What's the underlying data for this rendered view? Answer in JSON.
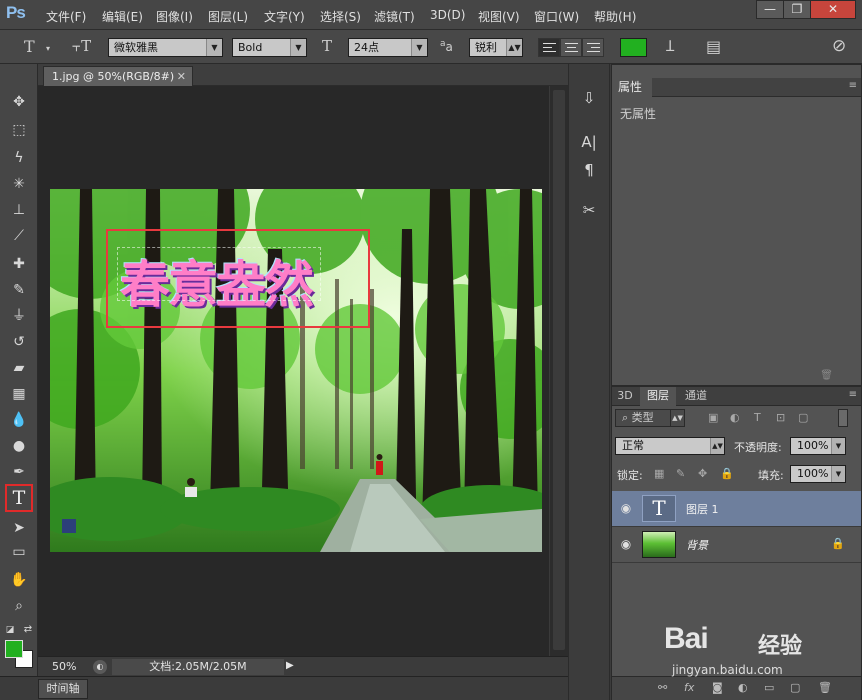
{
  "app": {
    "logo": "Ps"
  },
  "menu": [
    "文件(F)",
    "编辑(E)",
    "图像(I)",
    "图层(L)",
    "文字(Y)",
    "选择(S)",
    "滤镜(T)",
    "3D(D)",
    "视图(V)",
    "窗口(W)",
    "帮助(H)"
  ],
  "window_controls": {
    "minimize": "—",
    "restore": "❐",
    "close": "✕"
  },
  "options": {
    "font_family": "微软雅黑",
    "font_style": "Bold",
    "font_size": "24点",
    "aa_label": "a",
    "anti_alias": "锐利",
    "text_color": "#22b020"
  },
  "document": {
    "tab_title": "1.jpg @ 50%(RGB/8#)",
    "canvas_text": "春意盎然",
    "zoom": "50%",
    "doc_size": "文档:2.05M/2.05M",
    "timeline_tab": "时间轴"
  },
  "tools": {
    "foreground_color": "#22b020",
    "background_color": "#ffffff",
    "active_tool": "T"
  },
  "properties": {
    "tab": "属性",
    "empty": "无属性"
  },
  "layers": {
    "tabs": [
      "3D",
      "图层",
      "通道"
    ],
    "filter_kind": "类型",
    "blend_mode": "正常",
    "opacity_label": "不透明度:",
    "opacity": "100%",
    "lock_label": "锁定:",
    "fill_label": "填充:",
    "fill": "100%",
    "items": [
      {
        "name": "图层 1",
        "thumb": "T"
      },
      {
        "name": "背景"
      }
    ]
  },
  "watermark": {
    "brand": "Bai",
    "cn": "经验",
    "url": "jingyan.baidu.com"
  }
}
